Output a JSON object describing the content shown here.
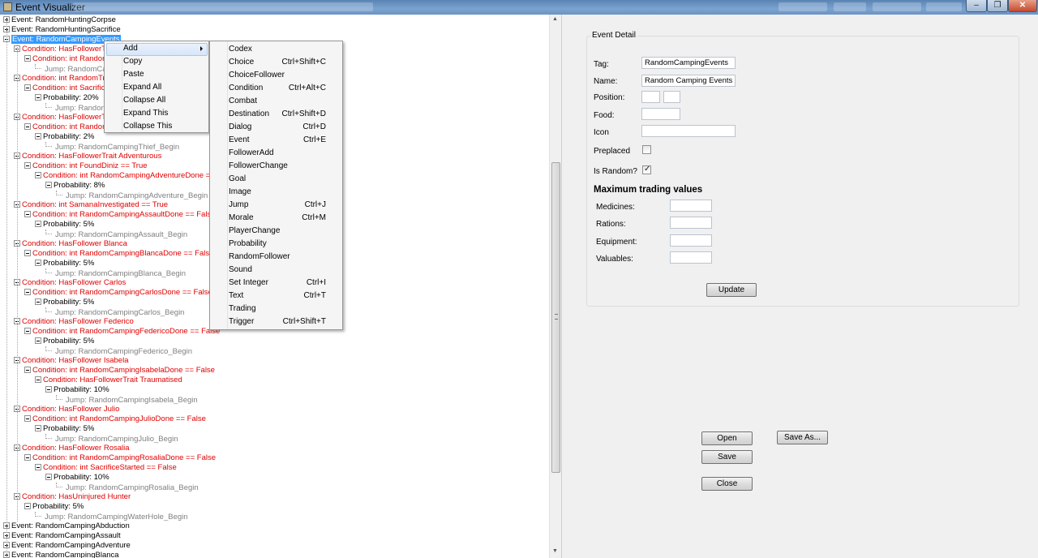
{
  "window": {
    "title": "Event Visualizer"
  },
  "tree": [
    {
      "label": "Event: RandomHuntingCorpse",
      "color": "black",
      "indent": 0,
      "toggle": "plus"
    },
    {
      "label": "Event: RandomHuntingSacrifice",
      "color": "black",
      "indent": 0,
      "toggle": "plus"
    },
    {
      "label": "Event: RandomCampingEvents",
      "color": "black",
      "indent": 0,
      "toggle": "minus",
      "selected": true
    },
    {
      "label": "Condition: HasFollowerT",
      "color": "red",
      "indent": 1,
      "toggle": "minus"
    },
    {
      "label": "Condition: int Random",
      "color": "red",
      "indent": 2,
      "toggle": "minus"
    },
    {
      "label": "Jump: RandomCa",
      "color": "grey",
      "indent": 3,
      "toggle": "none"
    },
    {
      "label": "Condition: int RandomTra",
      "color": "red",
      "indent": 1,
      "toggle": "minus"
    },
    {
      "label": "Condition: int Sacrific",
      "color": "red",
      "indent": 2,
      "toggle": "minus"
    },
    {
      "label": "Probability: 20%",
      "color": "black",
      "indent": 3,
      "toggle": "minus"
    },
    {
      "label": "Jump: Random",
      "color": "grey",
      "indent": 4,
      "toggle": "none"
    },
    {
      "label": "Condition: HasFollowerT",
      "color": "red",
      "indent": 1,
      "toggle": "minus"
    },
    {
      "label": "Condition: int Random",
      "color": "red",
      "indent": 2,
      "toggle": "minus"
    },
    {
      "label": "Probability: 2%",
      "color": "black",
      "indent": 3,
      "toggle": "minus"
    },
    {
      "label": "Jump: RandomCampingThief_Begin",
      "color": "grey",
      "indent": 4,
      "toggle": "none"
    },
    {
      "label": "Condition: HasFollowerTrait Adventurous",
      "color": "red",
      "indent": 1,
      "toggle": "minus"
    },
    {
      "label": "Condition: int FoundDiniz == True",
      "color": "red",
      "indent": 2,
      "toggle": "minus"
    },
    {
      "label": "Condition: int RandomCampingAdventureDone == F",
      "color": "red",
      "indent": 3,
      "toggle": "minus"
    },
    {
      "label": "Probability: 8%",
      "color": "black",
      "indent": 4,
      "toggle": "minus"
    },
    {
      "label": "Jump: RandomCampingAdventure_Begin",
      "color": "grey",
      "indent": 5,
      "toggle": "none"
    },
    {
      "label": "Condition: int SamanaInvestigated == True",
      "color": "red",
      "indent": 1,
      "toggle": "minus"
    },
    {
      "label": "Condition: int RandomCampingAssaultDone == False",
      "color": "red",
      "indent": 2,
      "toggle": "minus"
    },
    {
      "label": "Probability: 5%",
      "color": "black",
      "indent": 3,
      "toggle": "minus"
    },
    {
      "label": "Jump: RandomCampingAssault_Begin",
      "color": "grey",
      "indent": 4,
      "toggle": "none"
    },
    {
      "label": "Condition: HasFollower Blanca",
      "color": "red",
      "indent": 1,
      "toggle": "minus"
    },
    {
      "label": "Condition: int RandomCampingBlancaDone == False",
      "color": "red",
      "indent": 2,
      "toggle": "minus"
    },
    {
      "label": "Probability: 5%",
      "color": "black",
      "indent": 3,
      "toggle": "minus"
    },
    {
      "label": "Jump: RandomCampingBlanca_Begin",
      "color": "grey",
      "indent": 4,
      "toggle": "none"
    },
    {
      "label": "Condition: HasFollower Carlos",
      "color": "red",
      "indent": 1,
      "toggle": "minus"
    },
    {
      "label": "Condition: int RandomCampingCarlosDone == False",
      "color": "red",
      "indent": 2,
      "toggle": "minus"
    },
    {
      "label": "Probability: 5%",
      "color": "black",
      "indent": 3,
      "toggle": "minus"
    },
    {
      "label": "Jump: RandomCampingCarlos_Begin",
      "color": "grey",
      "indent": 4,
      "toggle": "none"
    },
    {
      "label": "Condition: HasFollower Federico",
      "color": "red",
      "indent": 1,
      "toggle": "minus"
    },
    {
      "label": "Condition: int RandomCampingFedericoDone == False",
      "color": "red",
      "indent": 2,
      "toggle": "minus"
    },
    {
      "label": "Probability: 5%",
      "color": "black",
      "indent": 3,
      "toggle": "minus"
    },
    {
      "label": "Jump: RandomCampingFederico_Begin",
      "color": "grey",
      "indent": 4,
      "toggle": "none"
    },
    {
      "label": "Condition: HasFollower Isabela",
      "color": "red",
      "indent": 1,
      "toggle": "minus"
    },
    {
      "label": "Condition: int RandomCampingIsabelaDone == False",
      "color": "red",
      "indent": 2,
      "toggle": "minus"
    },
    {
      "label": "Condition: HasFollowerTrait Traumatised",
      "color": "red",
      "indent": 3,
      "toggle": "minus"
    },
    {
      "label": "Probability: 10%",
      "color": "black",
      "indent": 4,
      "toggle": "minus"
    },
    {
      "label": "Jump: RandomCampingIsabela_Begin",
      "color": "grey",
      "indent": 5,
      "toggle": "none"
    },
    {
      "label": "Condition: HasFollower Julio",
      "color": "red",
      "indent": 1,
      "toggle": "minus"
    },
    {
      "label": "Condition: int RandomCampingJulioDone == False",
      "color": "red",
      "indent": 2,
      "toggle": "minus"
    },
    {
      "label": "Probability: 5%",
      "color": "black",
      "indent": 3,
      "toggle": "minus"
    },
    {
      "label": "Jump: RandomCampingJulio_Begin",
      "color": "grey",
      "indent": 4,
      "toggle": "none"
    },
    {
      "label": "Condition: HasFollower Rosalia",
      "color": "red",
      "indent": 1,
      "toggle": "minus"
    },
    {
      "label": "Condition: int RandomCampingRosaliaDone == False",
      "color": "red",
      "indent": 2,
      "toggle": "minus"
    },
    {
      "label": "Condition: int SacrificeStarted == False",
      "color": "red",
      "indent": 3,
      "toggle": "minus"
    },
    {
      "label": "Probability: 10%",
      "color": "black",
      "indent": 4,
      "toggle": "minus"
    },
    {
      "label": "Jump: RandomCampingRosalia_Begin",
      "color": "grey",
      "indent": 5,
      "toggle": "none"
    },
    {
      "label": "Condition: HasUninjured Hunter",
      "color": "red",
      "indent": 1,
      "toggle": "minus"
    },
    {
      "label": "Probability: 5%",
      "color": "black",
      "indent": 2,
      "toggle": "minus"
    },
    {
      "label": "Jump: RandomCampingWaterHole_Begin",
      "color": "grey",
      "indent": 3,
      "toggle": "none"
    },
    {
      "label": "Event: RandomCampingAbduction",
      "color": "black",
      "indent": 0,
      "toggle": "plus"
    },
    {
      "label": "Event: RandomCampingAssault",
      "color": "black",
      "indent": 0,
      "toggle": "plus"
    },
    {
      "label": "Event: RandomCampingAdventure",
      "color": "black",
      "indent": 0,
      "toggle": "plus"
    },
    {
      "label": "Event: RandomCampingBlanca",
      "color": "black",
      "indent": 0,
      "toggle": "plus"
    }
  ],
  "context_menu": {
    "items": [
      {
        "label": "Add",
        "submenu": true,
        "highlighted": true
      },
      {
        "label": "Copy"
      },
      {
        "label": "Paste"
      },
      {
        "label": "Expand All"
      },
      {
        "label": "Collapse All"
      },
      {
        "label": "Expand This"
      },
      {
        "label": "Collapse This"
      }
    ]
  },
  "add_submenu": {
    "items": [
      {
        "label": "Codex",
        "shortcut": ""
      },
      {
        "label": "Choice",
        "shortcut": "Ctrl+Shift+C"
      },
      {
        "label": "ChoiceFollower",
        "shortcut": ""
      },
      {
        "label": "Condition",
        "shortcut": "Ctrl+Alt+C"
      },
      {
        "label": "Combat",
        "shortcut": ""
      },
      {
        "label": "Destination",
        "shortcut": "Ctrl+Shift+D"
      },
      {
        "label": "Dialog",
        "shortcut": "Ctrl+D"
      },
      {
        "label": "Event",
        "shortcut": "Ctrl+E"
      },
      {
        "label": "FollowerAdd",
        "shortcut": ""
      },
      {
        "label": "FollowerChange",
        "shortcut": ""
      },
      {
        "label": "Goal",
        "shortcut": ""
      },
      {
        "label": "Image",
        "shortcut": ""
      },
      {
        "label": "Jump",
        "shortcut": "Ctrl+J"
      },
      {
        "label": "Morale",
        "shortcut": "Ctrl+M"
      },
      {
        "label": "PlayerChange",
        "shortcut": ""
      },
      {
        "label": "Probability",
        "shortcut": ""
      },
      {
        "label": "RandomFollower",
        "shortcut": ""
      },
      {
        "label": "Sound",
        "shortcut": ""
      },
      {
        "label": "Set Integer",
        "shortcut": "Ctrl+I"
      },
      {
        "label": "Text",
        "shortcut": "Ctrl+T"
      },
      {
        "label": "Trading",
        "shortcut": ""
      },
      {
        "label": "Trigger",
        "shortcut": "Ctrl+Shift+T"
      }
    ]
  },
  "detail": {
    "group_title": "Event Detail",
    "tag_label": "Tag:",
    "tag_value": "RandomCampingEvents",
    "name_label": "Name:",
    "name_value": "Random Camping Events",
    "position_label": "Position:",
    "position_x": "",
    "position_y": "",
    "food_label": "Food:",
    "food_value": "",
    "icon_label": "Icon",
    "icon_value": "",
    "preplaced_label": "Preplaced",
    "preplaced_checked": false,
    "is_random_label": "Is Random?",
    "is_random_checked": true,
    "max_trading_heading": "Maximum trading values",
    "medicines_label": "Medicines:",
    "medicines_value": "",
    "rations_label": "Rations:",
    "rations_value": "",
    "equipment_label": "Equipment:",
    "equipment_value": "",
    "valuables_label": "Valuables:",
    "valuables_value": "",
    "update_label": "Update"
  },
  "actions": {
    "open_label": "Open",
    "save_as_label": "Save As...",
    "save_label": "Save",
    "close_label": "Close"
  },
  "colors": {
    "selection": "#3399ff",
    "condition_text": "#e00000",
    "jump_text": "#808080"
  }
}
